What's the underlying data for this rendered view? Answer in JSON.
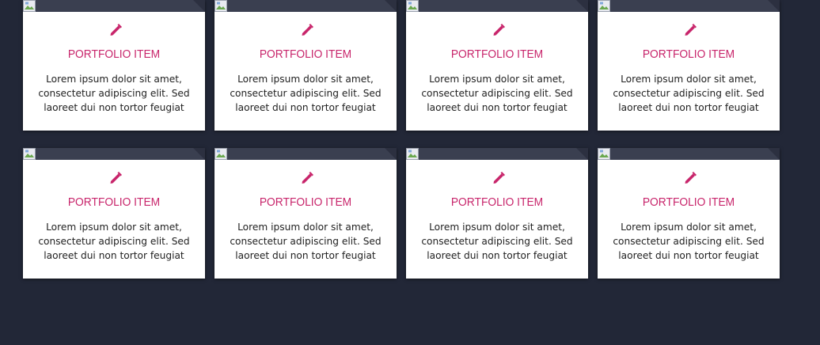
{
  "colors": {
    "background": "#222737",
    "card": "#ffffff",
    "accent": "#c8256b",
    "image_bar": "#3a3f50"
  },
  "cards": [
    {
      "icon": "pencil-icon",
      "title": "PORTFOLIO ITEM",
      "text": "Lorem ipsum dolor sit amet, consectetur adipiscing elit. Sed laoreet dui non tortor feugiat"
    },
    {
      "icon": "pencil-icon",
      "title": "PORTFOLIO ITEM",
      "text": "Lorem ipsum dolor sit amet, consectetur adipiscing elit. Sed laoreet dui non tortor feugiat"
    },
    {
      "icon": "pencil-icon",
      "title": "PORTFOLIO ITEM",
      "text": "Lorem ipsum dolor sit amet, consectetur adipiscing elit. Sed laoreet dui non tortor feugiat"
    },
    {
      "icon": "pencil-icon",
      "title": "PORTFOLIO ITEM",
      "text": "Lorem ipsum dolor sit amet, consectetur adipiscing elit. Sed laoreet dui non tortor feugiat"
    },
    {
      "icon": "pencil-icon",
      "title": "PORTFOLIO ITEM",
      "text": "Lorem ipsum dolor sit amet, consectetur adipiscing elit. Sed laoreet dui non tortor feugiat"
    },
    {
      "icon": "pencil-icon",
      "title": "PORTFOLIO ITEM",
      "text": "Lorem ipsum dolor sit amet, consectetur adipiscing elit. Sed laoreet dui non tortor feugiat"
    },
    {
      "icon": "pencil-icon",
      "title": "PORTFOLIO ITEM",
      "text": "Lorem ipsum dolor sit amet, consectetur adipiscing elit. Sed laoreet dui non tortor feugiat"
    },
    {
      "icon": "pencil-icon",
      "title": "PORTFOLIO ITEM",
      "text": "Lorem ipsum dolor sit amet, consectetur adipiscing elit. Sed laoreet dui non tortor feugiat"
    }
  ]
}
